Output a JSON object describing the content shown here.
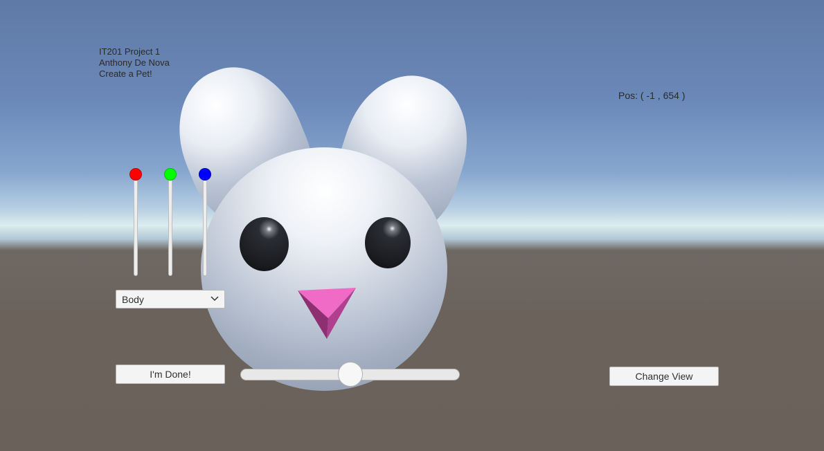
{
  "info": {
    "line1": "IT201 Project 1",
    "line2": "Anthony De Nova",
    "line3": "Create a Pet!"
  },
  "position_readout": "Pos: ( -1 , 654 )",
  "color_sliders": [
    {
      "channel": "red",
      "color": "#ff0000",
      "value": 1.0
    },
    {
      "channel": "green",
      "color": "#00ff00",
      "value": 1.0
    },
    {
      "channel": "blue",
      "color": "#0000ff",
      "value": 1.0
    }
  ],
  "part_dropdown": {
    "selected": "Body"
  },
  "buttons": {
    "done_label": "I'm Done!",
    "change_view_label": "Change View"
  },
  "size_slider": {
    "value": 0.5
  },
  "pet_colors": {
    "body": "#ffffff",
    "nose": "#e65cb8",
    "eyes": "#1a1b1f"
  }
}
